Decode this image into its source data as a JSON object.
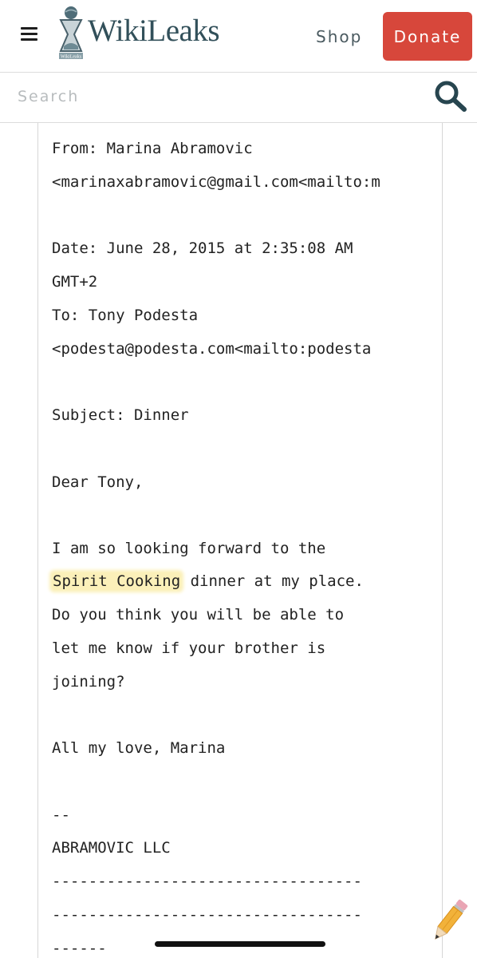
{
  "header": {
    "brand": "WikiLeaks",
    "logo_text": "WikiLeaks",
    "shop_label": "Shop",
    "donate_label": "Donate",
    "donate_color": "#d7473b"
  },
  "search": {
    "placeholder": "Search",
    "value": ""
  },
  "email": {
    "lines": [
      "From: Marina Abramovic",
      "<marinaxabramovic@gmail.com<mailto:m",
      "Date: June 28, 2015 at 2:35:08 AM",
      "GMT+2",
      "To: Tony Podesta",
      "<podesta@podesta.com<mailto:podesta",
      "Subject: Dinner",
      "Dear Tony,",
      "I am so looking forward to the",
      "Spirit Cooking",
      " dinner at my place.",
      "Do you think you will be able to",
      "let me know if your brother is",
      "joining?",
      "All my love, Marina",
      "--",
      "ABRAMOVIC LLC",
      "----------------------------------",
      "----------------------------------",
      "------"
    ],
    "highlight_color": "#fbf0b9"
  },
  "icons": {
    "menu": "hamburger-menu-icon",
    "logo": "hourglass-logo-icon",
    "search": "magnifier-icon",
    "markup": "pencil-icon"
  }
}
